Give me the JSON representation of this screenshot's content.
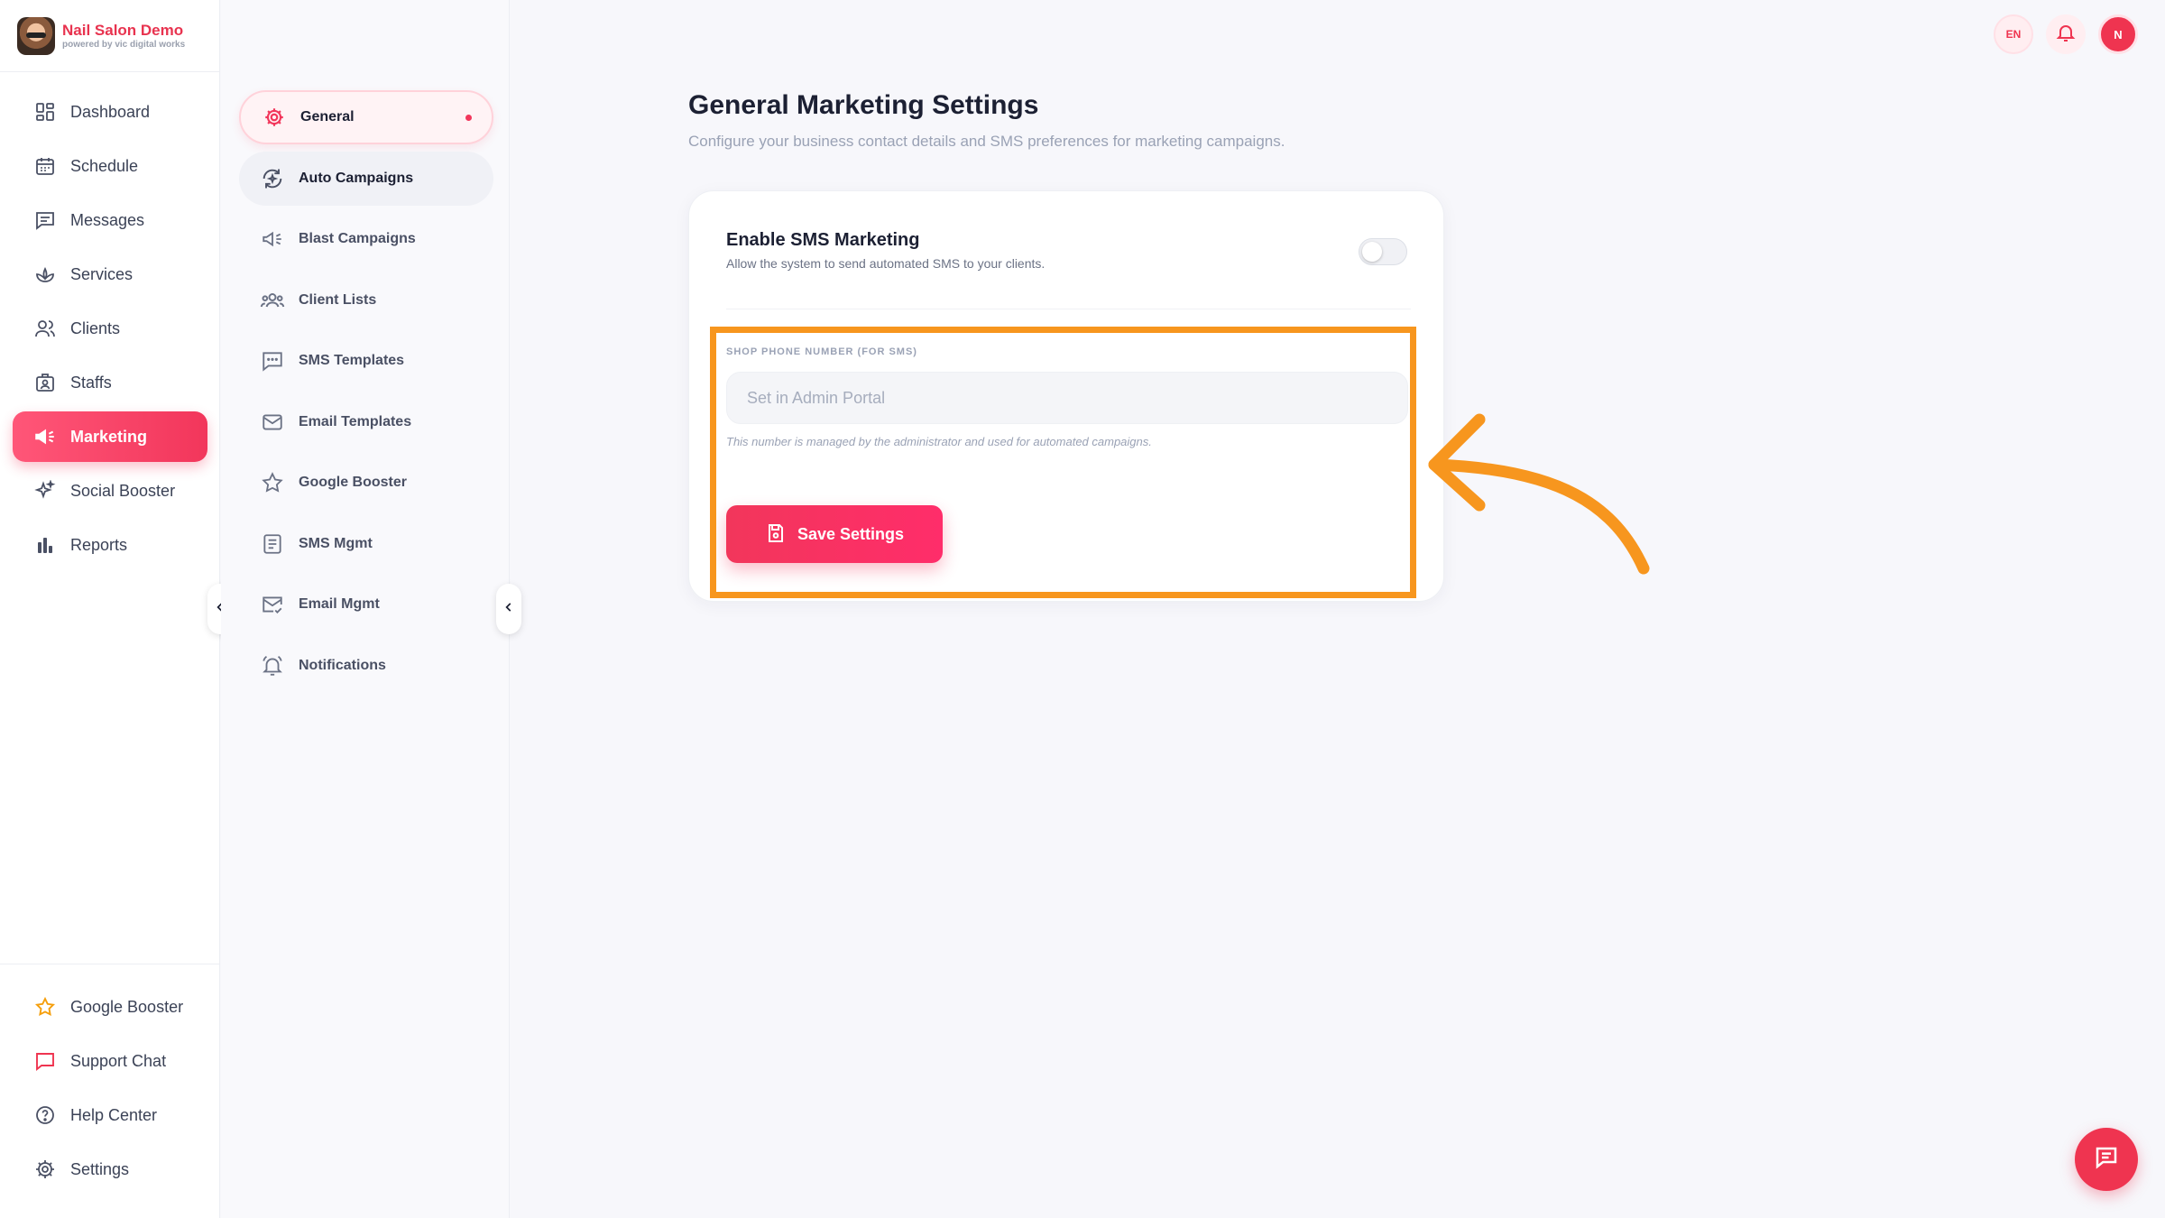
{
  "brand": {
    "name": "Nail Salon Demo",
    "tagline": "powered by vic digital works"
  },
  "sidebar": {
    "items": [
      {
        "label": "Dashboard",
        "icon": "dashboard-icon"
      },
      {
        "label": "Schedule",
        "icon": "calendar-icon"
      },
      {
        "label": "Messages",
        "icon": "message-icon"
      },
      {
        "label": "Services",
        "icon": "lotus-icon"
      },
      {
        "label": "Clients",
        "icon": "users-icon"
      },
      {
        "label": "Staffs",
        "icon": "staff-icon"
      },
      {
        "label": "Marketing",
        "icon": "megaphone-icon",
        "active": true
      },
      {
        "label": "Social Booster",
        "icon": "sparkle-icon"
      },
      {
        "label": "Reports",
        "icon": "bar-chart-icon"
      }
    ],
    "bottom_items": [
      {
        "label": "Google Booster",
        "icon": "star-icon"
      },
      {
        "label": "Support Chat",
        "icon": "chat-icon"
      },
      {
        "label": "Help Center",
        "icon": "help-icon"
      },
      {
        "label": "Settings",
        "icon": "gear-icon"
      }
    ]
  },
  "submenu": {
    "items": [
      {
        "label": "General",
        "icon": "gear-icon",
        "active": true
      },
      {
        "label": "Auto Campaigns",
        "icon": "refresh-icon"
      },
      {
        "label": "Blast Campaigns",
        "icon": "megaphone-icon"
      },
      {
        "label": "Client Lists",
        "icon": "group-icon"
      },
      {
        "label": "SMS Templates",
        "icon": "sms-icon"
      },
      {
        "label": "Email Templates",
        "icon": "mail-icon"
      },
      {
        "label": "Google Booster",
        "icon": "star-icon"
      },
      {
        "label": "SMS Mgmt",
        "icon": "list-icon"
      },
      {
        "label": "Email Mgmt",
        "icon": "mail-check-icon"
      },
      {
        "label": "Notifications",
        "icon": "bell-icon"
      }
    ]
  },
  "topbar": {
    "language": "EN",
    "avatar_initial": "N"
  },
  "main": {
    "title": "General Marketing Settings",
    "subtitle": "Configure your business contact details and SMS preferences for marketing campaigns.",
    "sms": {
      "title": "Enable SMS Marketing",
      "description": "Allow the system to send automated SMS to your clients.",
      "enabled": false
    },
    "phone": {
      "label": "SHOP PHONE NUMBER (FOR SMS)",
      "placeholder": "Set in Admin Portal",
      "value": "",
      "note": "This number is managed by the administrator and used for automated campaigns."
    },
    "save_label": "Save Settings"
  },
  "colors": {
    "accent": "#f2365b",
    "highlight": "#f7961e",
    "background": "#f7f7fb"
  }
}
